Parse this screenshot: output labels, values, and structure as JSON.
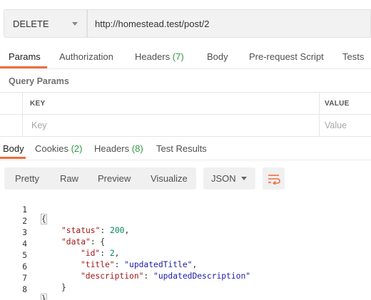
{
  "request": {
    "method": "DELETE",
    "url": "http://homestead.test/post/2"
  },
  "request_tabs": [
    {
      "label": "Params",
      "count": ""
    },
    {
      "label": "Authorization",
      "count": ""
    },
    {
      "label": "Headers",
      "count": "(7)"
    },
    {
      "label": "Body",
      "count": ""
    },
    {
      "label": "Pre-request Script",
      "count": ""
    },
    {
      "label": "Tests",
      "count": ""
    }
  ],
  "query_params": {
    "title": "Query Params",
    "key_header": "KEY",
    "value_header": "VALUE",
    "key_placeholder": "Key",
    "value_placeholder": "Value"
  },
  "response_tabs": [
    {
      "label": "Body",
      "count": ""
    },
    {
      "label": "Cookies",
      "count": "(2)"
    },
    {
      "label": "Headers",
      "count": "(8)"
    },
    {
      "label": "Test Results",
      "count": ""
    }
  ],
  "view_modes": [
    "Pretty",
    "Raw",
    "Preview",
    "Visualize"
  ],
  "format": "JSON",
  "icons": {
    "wrap": "wrap-lines-icon",
    "caret": "chevron-down-icon"
  },
  "colors": {
    "accent": "#f26b3a",
    "count_green": "#2e9d41",
    "json_key": "#a31515",
    "json_string": "#1a1aa6",
    "json_number": "#098658"
  },
  "response_body": {
    "line_numbers": [
      "1",
      "2",
      "3",
      "4",
      "5",
      "6",
      "7",
      "8"
    ],
    "l1_brace": "{",
    "l2_key": "\"status\"",
    "l2_sep": ": ",
    "l2_val": "200",
    "l2_end": ",",
    "l3_key": "\"data\"",
    "l3_sep": ": {",
    "l4_key": "\"id\"",
    "l4_sep": ": ",
    "l4_val": "2",
    "l4_end": ",",
    "l5_key": "\"title\"",
    "l5_sep": ": ",
    "l5_val": "\"updatedTitle\"",
    "l5_end": ",",
    "l6_key": "\"description\"",
    "l6_sep": ": ",
    "l6_val": "\"updatedDescription\"",
    "l7_brace": "}",
    "l8_brace": "}"
  }
}
